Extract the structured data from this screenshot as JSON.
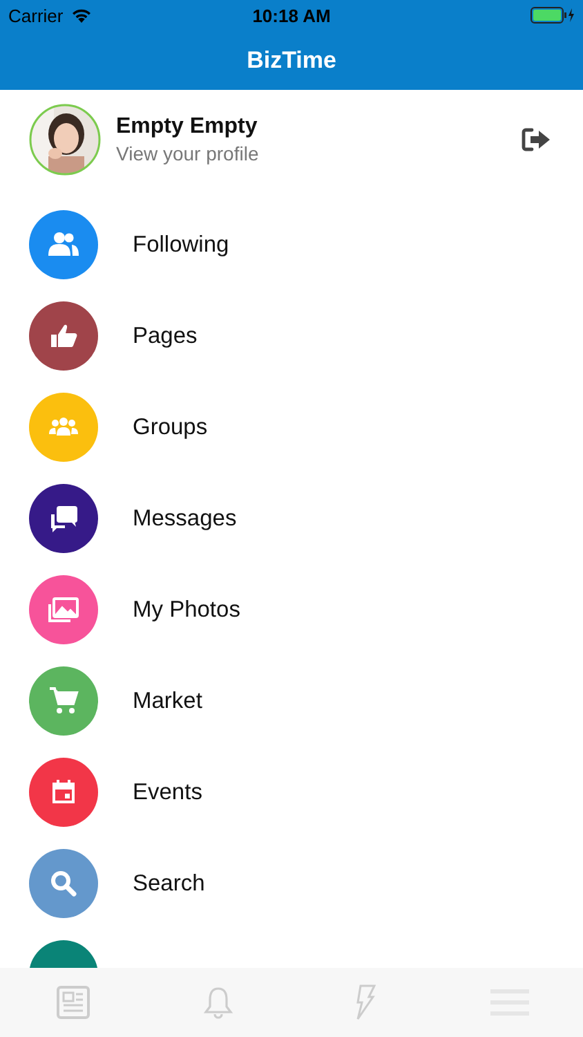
{
  "status_bar": {
    "carrier": "Carrier",
    "time": "10:18 AM"
  },
  "nav_bar": {
    "title": "BizTime"
  },
  "profile": {
    "name": "Empty Empty",
    "subtitle": "View your profile"
  },
  "menu": [
    {
      "kind": "following",
      "label": "Following",
      "color": "#1a8cf0"
    },
    {
      "kind": "pages",
      "label": "Pages",
      "color": "#a0444a"
    },
    {
      "kind": "groups",
      "label": "Groups",
      "color": "#fbbf0e"
    },
    {
      "kind": "messages",
      "label": "Messages",
      "color": "#361a88"
    },
    {
      "kind": "photos",
      "label": "My Photos",
      "color": "#f7539a"
    },
    {
      "kind": "market",
      "label": "Market",
      "color": "#5cb55f"
    },
    {
      "kind": "events",
      "label": "Events",
      "color": "#f23648"
    },
    {
      "kind": "search",
      "label": "Search",
      "color": "#6498cc"
    },
    {
      "kind": "partial",
      "color": "#0a8477"
    }
  ],
  "tab_bar": [
    {
      "kind": "news"
    },
    {
      "kind": "bell"
    },
    {
      "kind": "bolt"
    },
    {
      "kind": "menu"
    }
  ]
}
